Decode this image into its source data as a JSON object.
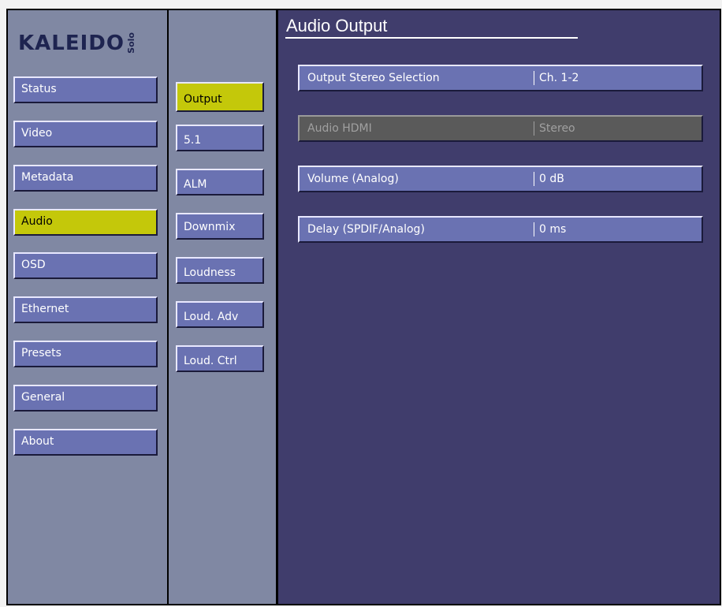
{
  "brand": {
    "name": "KALEIDO",
    "edition": "Solo"
  },
  "page_title": "Audio Output",
  "nav_main": [
    {
      "label": "Status",
      "active": false
    },
    {
      "label": "Video",
      "active": false
    },
    {
      "label": "Metadata",
      "active": false
    },
    {
      "label": "Audio",
      "active": true
    },
    {
      "label": "OSD",
      "active": false
    },
    {
      "label": "Ethernet",
      "active": false
    },
    {
      "label": "Presets",
      "active": false
    },
    {
      "label": "General",
      "active": false
    },
    {
      "label": "About",
      "active": false
    }
  ],
  "nav_sub": [
    {
      "label": "Output",
      "active": true
    },
    {
      "label": "5.1",
      "active": false
    },
    {
      "label": "ALM",
      "active": false
    },
    {
      "label": "Downmix",
      "active": false
    },
    {
      "label": "Loudness",
      "active": false
    },
    {
      "label": "Loud. Adv",
      "active": false
    },
    {
      "label": "Loud. Ctrl",
      "active": false
    }
  ],
  "settings": [
    {
      "label": "Output Stereo Selection",
      "value": "Ch. 1-2",
      "enabled": true
    },
    {
      "label": "Audio HDMI",
      "value": "Stereo",
      "enabled": false
    },
    {
      "label": "Volume (Analog)",
      "value": "0 dB",
      "enabled": true
    },
    {
      "label": "Delay (SPDIF/Analog)",
      "value": "0 ms",
      "enabled": true
    }
  ],
  "colors": {
    "active": "#c4c80a",
    "button": "#6a72b2",
    "panel": "#403d6c",
    "sidebar": "#8088a3",
    "disabled": "#5a5a5a"
  }
}
